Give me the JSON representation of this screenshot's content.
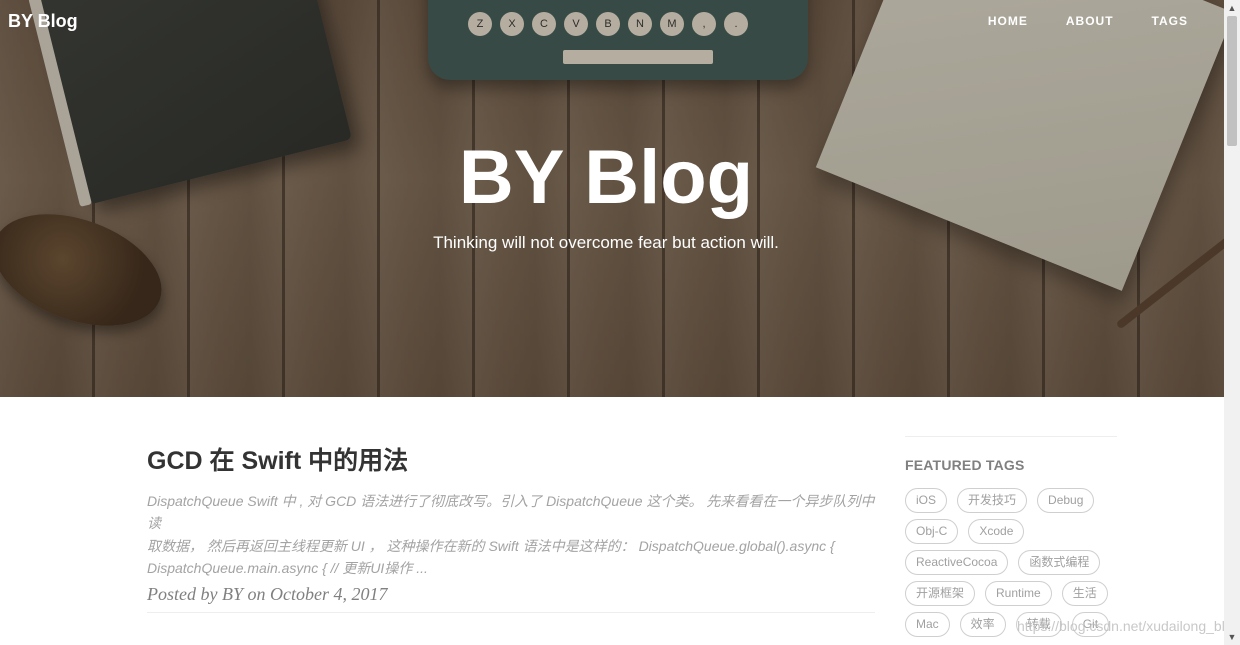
{
  "nav": {
    "brand": "BY Blog",
    "links": [
      "HOME",
      "ABOUT",
      "TAGS"
    ]
  },
  "hero": {
    "title": "BY Blog",
    "subtitle": "Thinking will not overcome fear but action will."
  },
  "post": {
    "title": "GCD 在 Swift 中的用法",
    "excerpt_line1": "DispatchQueue Swift 中 , 对 GCD 语法进行了彻底改写。引入了 DispatchQueue 这个类。 先来看看在一个异步队列中读",
    "excerpt_line2": "取数据， 然后再返回主线程更新 UI ， 这种操作在新的 Swift 语法中是这样的： DispatchQueue.global().async {",
    "excerpt_line3": "DispatchQueue.main.async { // 更新UI操作 ...",
    "meta": "Posted by BY on October 4, 2017"
  },
  "sidebar": {
    "heading": "FEATURED TAGS",
    "tags": [
      "iOS",
      "开发技巧",
      "Debug",
      "Obj-C",
      "Xcode",
      "ReactiveCocoa",
      "函数式编程",
      "开源框架",
      "Runtime",
      "生活",
      "Mac",
      "效率",
      "转载",
      "Git"
    ]
  },
  "watermark": "https://blog.csdn.net/xudailong_blog",
  "decor": {
    "typewriter_keys": [
      "Z",
      "X",
      "C",
      "V",
      "B",
      "N",
      "M",
      ",",
      "."
    ]
  },
  "colors": {
    "hero_overlay": "#6f5c49",
    "title_text": "#333333",
    "excerpt_text": "#a3a3a3",
    "tag_border": "#cfcfcf"
  }
}
